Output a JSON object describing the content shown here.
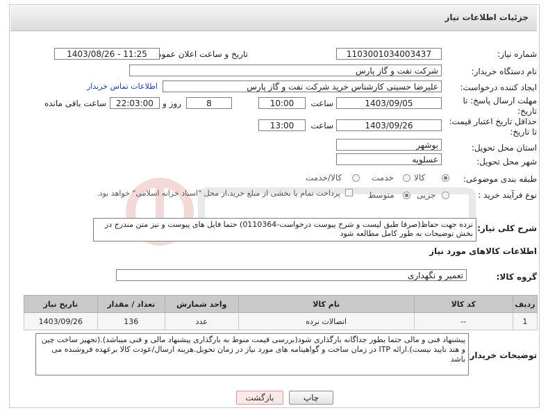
{
  "header": {
    "title": "جزئیات اطلاعات نیاز"
  },
  "fields": {
    "need_number_label": "شماره نیاز:",
    "need_number": "1103001034003437",
    "announce_label": "تاریخ و ساعت اعلان عمومی:",
    "announce_value": "1403/08/26 - 11:25",
    "buyer_org_label": "نام دستگاه خریدار:",
    "buyer_org": "شرکت نفت و گاز پارس",
    "creator_label": "ایجاد کننده درخواست:",
    "creator": "علیرضا حسینی کارشناس خرید شرکت نفت و گاز پارس",
    "contact_link": "اطلاعات تماس خریدار",
    "deadline_label": "مهلت ارسال پاسخ: تا تاریخ:",
    "deadline_date": "1403/09/05",
    "time_word": "ساعت",
    "deadline_time": "10:00",
    "days_count": "8",
    "days_word": "روز و",
    "remaining_time": "22:03:00",
    "remaining_word": "ساعت باقی مانده",
    "validity_label": "حداقل تاریخ اعتبار قیمت: تا تاریخ:",
    "validity_date": "1403/09/26",
    "validity_time": "13:00",
    "province_label": "استان محل تحویل:",
    "province": "بوشهر",
    "city_label": "شهر محل تحویل:",
    "city": "عسلویه",
    "category_label": "طبقه بندی موضوعی:",
    "category_options": [
      "کالا",
      "خدمت",
      "کالا/خدمت"
    ],
    "process_label": "نوع فرآیند خرید :",
    "process_options": [
      "جزیی",
      "متوسط"
    ],
    "payment_note": "پرداخت تمام یا بخشی از مبلغ خرید،از محل \"اسناد خزانه اسلامی\" خواهد بود."
  },
  "description": {
    "label": "شرح کلی نیاز:",
    "text": "نرده جهت حفاظ(صرفا طبق لیست و شرح پیوست درخواست-0110364) حتما فایل های پیوست و نیز متن مندرج در بخش توضیحات به طور کامل مطالعه شود"
  },
  "goods_section": {
    "title": "اطلاعات کالاهای مورد نیاز",
    "group_label": "گروه کالا:",
    "group_value": "تعمیر و نگهداری",
    "columns": [
      "ردیف",
      "کد کالا",
      "نام کالا",
      "واحد شمارش",
      "تعداد / مقدار",
      "تاریخ نیاز"
    ],
    "rows": [
      {
        "row": "1",
        "code": "--",
        "name": "اتصالات نرده",
        "unit": "عدد",
        "qty": "136",
        "date": "1403/09/26"
      }
    ]
  },
  "buyer_notes": {
    "label": "توضیحات خریدار:",
    "text": "پیشنهاد فنی و مالی حتما  بطور جداگانه بارگذاری شود(بررسی قیمت منوط به بارگذاری پیشنهاد مالی و فنی میباشد).(تجهیز ساخت چین و هند تایید نیست).ارائه ITP در زمان ساخت و گواهینامه های مورد نیاز در زمان تحویل.هزینه ارسال/عودت کالا برعهده فروشنده می باشد"
  },
  "buttons": {
    "print": "چاپ",
    "back": "بازگشت"
  },
  "colors": {
    "link": "#1a3fb0",
    "back_button_bg": "#fde8e8",
    "header_bg": "#dcdcdc"
  }
}
